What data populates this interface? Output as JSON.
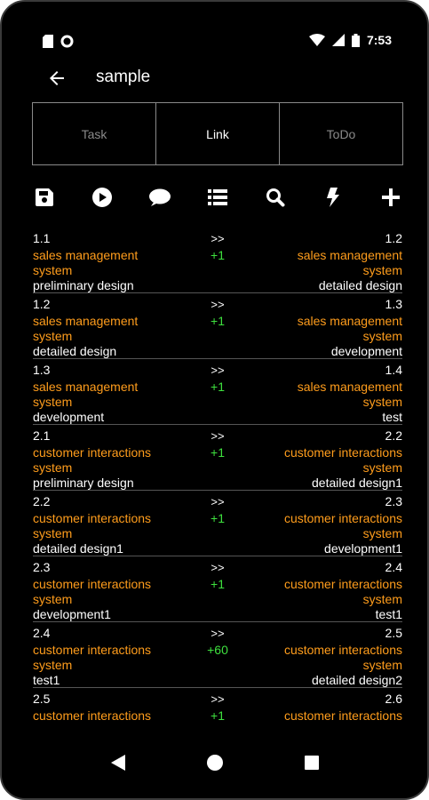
{
  "status_bar": {
    "time": "7:53"
  },
  "appbar": {
    "title": "sample"
  },
  "tabs": [
    {
      "label": "Task",
      "active": false
    },
    {
      "label": "Link",
      "active": true
    },
    {
      "label": "ToDo",
      "active": false
    }
  ],
  "toolbar": [
    "save-icon",
    "play-icon",
    "comment-icon",
    "list-icon",
    "search-icon",
    "bolt-icon",
    "plus-icon"
  ],
  "links": [
    {
      "from_id": "1.1",
      "from_system": "sales management system",
      "from_task": "preliminary design",
      "arrow": ">>",
      "delta": "+1",
      "to_id": "1.2",
      "to_system": "sales management system",
      "to_task": "detailed design"
    },
    {
      "from_id": "1.2",
      "from_system": "sales management system",
      "from_task": "detailed design",
      "arrow": ">>",
      "delta": "+1",
      "to_id": "1.3",
      "to_system": "sales management system",
      "to_task": "development"
    },
    {
      "from_id": "1.3",
      "from_system": "sales management system",
      "from_task": "development",
      "arrow": ">>",
      "delta": "+1",
      "to_id": "1.4",
      "to_system": "sales management system",
      "to_task": "test"
    },
    {
      "from_id": "2.1",
      "from_system": "customer interactions system",
      "from_task": "preliminary design",
      "arrow": ">>",
      "delta": "+1",
      "to_id": "2.2",
      "to_system": "customer interactions system",
      "to_task": "detailed design1"
    },
    {
      "from_id": "2.2",
      "from_system": "customer interactions system",
      "from_task": "detailed design1",
      "arrow": ">>",
      "delta": "+1",
      "to_id": "2.3",
      "to_system": "customer interactions system",
      "to_task": "development1"
    },
    {
      "from_id": "2.3",
      "from_system": "customer interactions system",
      "from_task": "development1",
      "arrow": ">>",
      "delta": "+1",
      "to_id": "2.4",
      "to_system": "customer interactions system",
      "to_task": "test1"
    },
    {
      "from_id": "2.4",
      "from_system": "customer interactions system",
      "from_task": "test1",
      "arrow": ">>",
      "delta": "+60",
      "to_id": "2.5",
      "to_system": "customer interactions system",
      "to_task": "detailed design2"
    },
    {
      "from_id": "2.5",
      "from_system": "customer interactions",
      "from_task": "",
      "arrow": ">>",
      "delta": "+1",
      "to_id": "2.6",
      "to_system": "customer interactions",
      "to_task": ""
    }
  ],
  "colors": {
    "background": "#000000",
    "system_text": "#ff9d1c",
    "delta_text": "#3ee03e",
    "divider": "#555555"
  }
}
